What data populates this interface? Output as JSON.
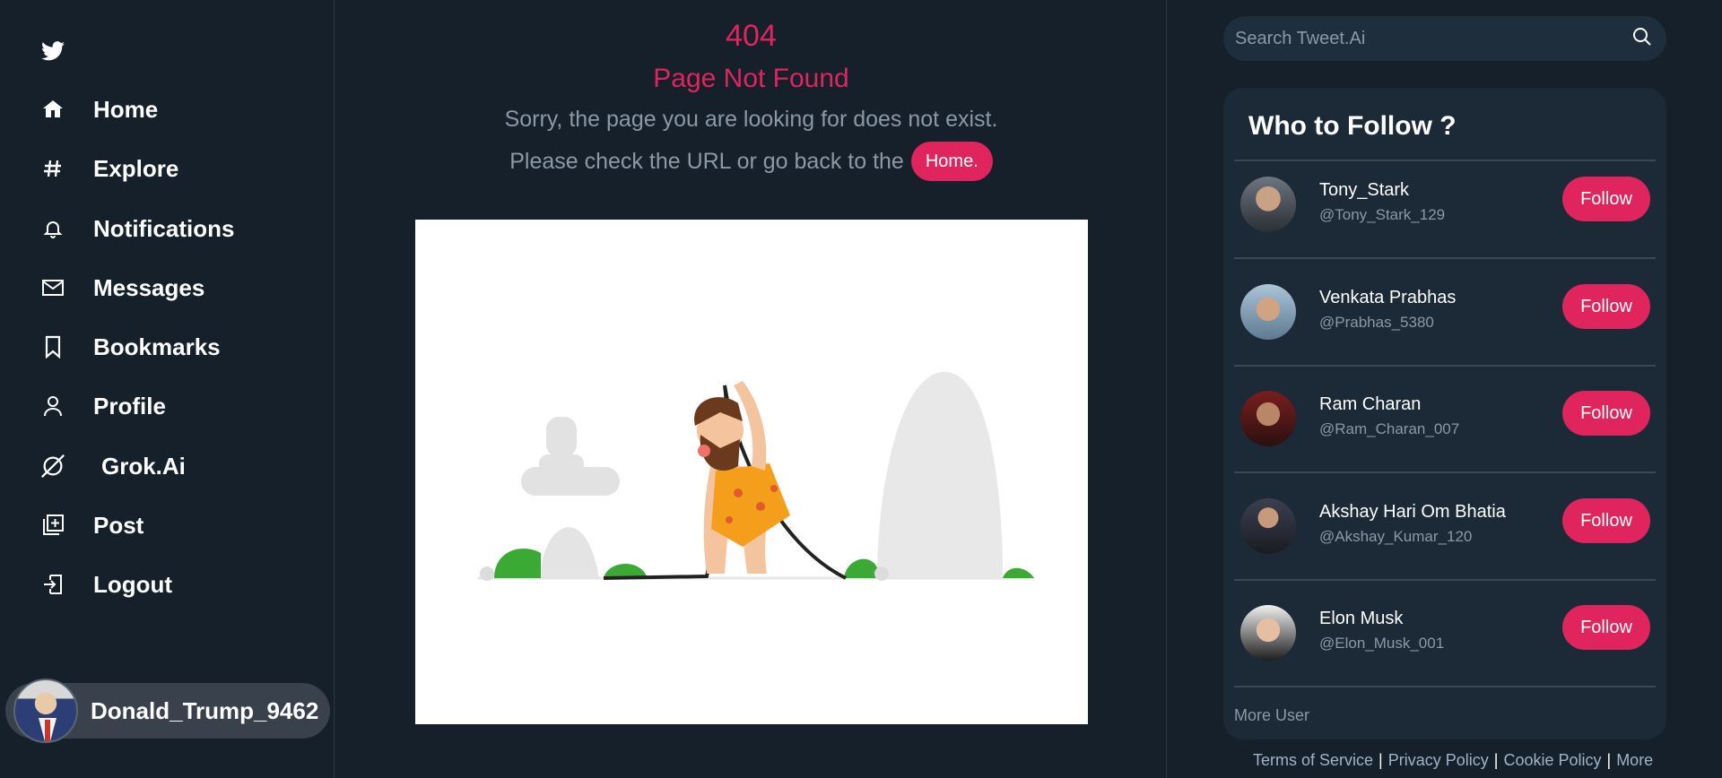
{
  "sidebar": {
    "items": [
      {
        "label": "Home",
        "icon": "home-icon"
      },
      {
        "label": "Explore",
        "icon": "hashtag-icon"
      },
      {
        "label": "Notifications",
        "icon": "bell-icon"
      },
      {
        "label": "Messages",
        "icon": "mail-icon"
      },
      {
        "label": "Bookmarks",
        "icon": "bookmark-icon"
      },
      {
        "label": "Profile",
        "icon": "user-icon"
      },
      {
        "label": "Grok.Ai",
        "icon": "grok-icon"
      },
      {
        "label": "Post",
        "icon": "add-post-icon"
      },
      {
        "label": "Logout",
        "icon": "logout-icon"
      }
    ],
    "user": {
      "name": "Donald_Trump_9462"
    }
  },
  "main": {
    "code": "404",
    "title": "Page Not Found",
    "message": "Sorry, the page you are looking for does not exist.",
    "message2": "Please check the URL or go back to the",
    "home_button": "Home."
  },
  "right": {
    "search_placeholder": "Search Tweet.Ai",
    "follow_title": "Who to Follow ?",
    "users": [
      {
        "name": "Tony_Stark",
        "handle": "@Tony_Stark_129",
        "button": "Follow"
      },
      {
        "name": "Venkata Prabhas",
        "handle": "@Prabhas_5380",
        "button": "Follow"
      },
      {
        "name": "Ram Charan",
        "handle": "@Ram_Charan_007",
        "button": "Follow"
      },
      {
        "name": "Akshay Hari Om Bhatia",
        "handle": "@Akshay_Kumar_120",
        "button": "Follow"
      },
      {
        "name": "Elon Musk",
        "handle": "@Elon_Musk_001",
        "button": "Follow"
      }
    ],
    "more_user": "More User",
    "footer": {
      "terms": "Terms of Service",
      "privacy": "Privacy Policy",
      "cookie": "Cookie Policy",
      "more": "More",
      "separator": "|"
    }
  },
  "colors": {
    "accent": "#e0245e",
    "background": "#15202b",
    "panel": "#1c2a38",
    "muted": "#8b98a5"
  }
}
